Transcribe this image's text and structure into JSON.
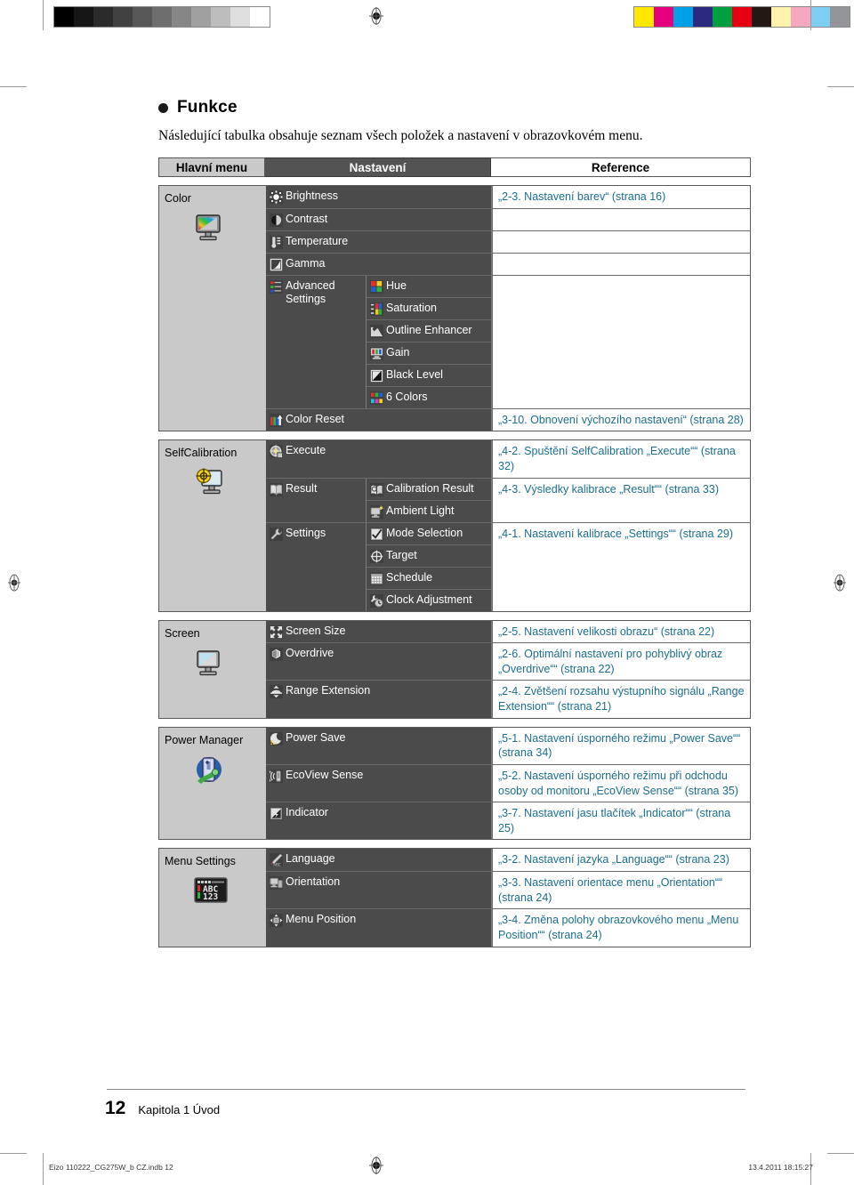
{
  "print_marks": {
    "gray_bar": [
      "#000000",
      "#161616",
      "#2b2b2b",
      "#414141",
      "#575757",
      "#6e6e6e",
      "#868686",
      "#a0a0a0",
      "#bdbdbd",
      "#dedede",
      "#ffffff"
    ],
    "color_bar": [
      "#ffe800",
      "#e6007e",
      "#00a0e9",
      "#2b2a80",
      "#00a040",
      "#e60012",
      "#231815",
      "#fdf3ac",
      "#f6a8c0",
      "#7ecef4",
      "#939598"
    ]
  },
  "heading": {
    "bullet_label": "Funkce"
  },
  "intro": "Následující tabulka obsahuje seznam všech položek a nastavení v obrazovkovém menu.",
  "table": {
    "headers": {
      "main_menu": "Hlavní menu",
      "settings": "Nastavení",
      "reference": "Reference"
    },
    "groups": [
      {
        "label": "Color",
        "icon": "monitor-rainbow-icon",
        "rows": [
          {
            "type": "simple",
            "icon": "brightness-icon",
            "label": "Brightness",
            "reference": "„2-3. Nastavení barev“ (strana 16)"
          },
          {
            "type": "simple",
            "icon": "contrast-icon",
            "label": "Contrast",
            "reference": ""
          },
          {
            "type": "simple",
            "icon": "temperature-icon",
            "label": "Temperature",
            "reference": ""
          },
          {
            "type": "simple",
            "icon": "gamma-icon",
            "label": "Gamma",
            "reference": ""
          },
          {
            "type": "nested",
            "icon": "advanced-settings-icon",
            "label": "Advanced Settings",
            "reference": "",
            "children": [
              {
                "icon": "hue-icon",
                "label": "Hue"
              },
              {
                "icon": "saturation-icon",
                "label": "Saturation"
              },
              {
                "icon": "outline-enhancer-icon",
                "label": "Outline Enhancer"
              },
              {
                "icon": "gain-icon",
                "label": "Gain"
              },
              {
                "icon": "black-level-icon",
                "label": "Black Level"
              },
              {
                "icon": "six-colors-icon",
                "label": "6 Colors"
              }
            ]
          },
          {
            "type": "simple",
            "icon": "color-reset-icon",
            "label": "Color Reset",
            "reference": "„3-10. Obnovení výchozího nastavení“ (strana 28)"
          }
        ]
      },
      {
        "label": "SelfCalibration",
        "icon": "monitor-target-icon",
        "rows": [
          {
            "type": "simple",
            "icon": "execute-icon",
            "label": "Execute",
            "reference": "„4-2. Spuštění SelfCalibration „Execute““ (strana 32)"
          },
          {
            "type": "nested",
            "icon": "result-icon",
            "label": "Result",
            "reference": "„4-3. Výsledky kalibrace „Result““ (strana 33)",
            "children": [
              {
                "icon": "calibration-result-icon",
                "label": "Calibration Result"
              },
              {
                "icon": "ambient-light-icon",
                "label": "Ambient Light"
              }
            ]
          },
          {
            "type": "nested",
            "icon": "settings-wrench-icon",
            "label": "Settings",
            "reference": "„4-1. Nastavení kalibrace „Settings““ (strana 29)",
            "children": [
              {
                "icon": "mode-selection-icon",
                "label": "Mode Selection"
              },
              {
                "icon": "target-icon",
                "label": "Target"
              },
              {
                "icon": "schedule-icon",
                "label": "Schedule"
              },
              {
                "icon": "clock-adjustment-icon",
                "label": "Clock Adjustment"
              }
            ]
          }
        ]
      },
      {
        "label": "Screen",
        "icon": "monitor-screen-icon",
        "rows": [
          {
            "type": "simple",
            "icon": "screen-size-icon",
            "label": "Screen Size",
            "reference": "„2-5. Nastavení velikosti obrazu“ (strana 22)"
          },
          {
            "type": "simple",
            "icon": "overdrive-icon",
            "label": "Overdrive",
            "reference": "„2-6. Optimální nastavení pro pohyblivý obraz „Overdrive““ (strana 22)"
          },
          {
            "type": "simple",
            "icon": "range-extension-icon",
            "label": "Range Extension",
            "reference": "„2-4. Zvětšení rozsahu výstupního signálu „Range Extension““ (strana 21)"
          }
        ]
      },
      {
        "label": "Power Manager",
        "icon": "battery-plug-icon",
        "rows": [
          {
            "type": "simple",
            "icon": "power-save-icon",
            "label": "Power Save",
            "reference": "„5-1. Nastavení úsporného režimu „Power Save““ (strana 34)"
          },
          {
            "type": "simple",
            "icon": "ecoview-sense-icon",
            "label": "EcoView Sense",
            "reference": "„5-2. Nastavení úsporného režimu při odchodu osoby od monitoru „EcoView Sense““ (strana 35)"
          },
          {
            "type": "simple",
            "icon": "indicator-icon",
            "label": "Indicator",
            "reference": "„3-7. Nastavení jasu tlačítek „Indicator““ (strana 25)"
          }
        ]
      },
      {
        "label": "Menu Settings",
        "icon": "abc123-icon",
        "rows": [
          {
            "type": "simple",
            "icon": "language-icon",
            "label": "Language",
            "reference": "„3-2. Nastavení jazyka „Language““ (strana 23)"
          },
          {
            "type": "simple",
            "icon": "orientation-icon",
            "label": "Orientation",
            "reference": "„3-3. Nastavení orientace menu „Orientation““ (strana 24)"
          },
          {
            "type": "simple",
            "icon": "menu-position-icon",
            "label": "Menu Position",
            "reference": "„3-4. Změna polohy obrazovkového menu „Menu Position““ (strana 24)"
          }
        ]
      }
    ]
  },
  "footer": {
    "page_number": "12",
    "chapter": "Kapitola 1 Úvod",
    "slug_left": "Eizo 110222_CG275W_b CZ.indb   12",
    "slug_right": "13.4.2011   18:15:27"
  },
  "colors": {
    "link": "#1b6f91",
    "panel_dark": "#4b4b4b",
    "panel_light": "#c9c9c9",
    "header_dark": "#535353"
  }
}
